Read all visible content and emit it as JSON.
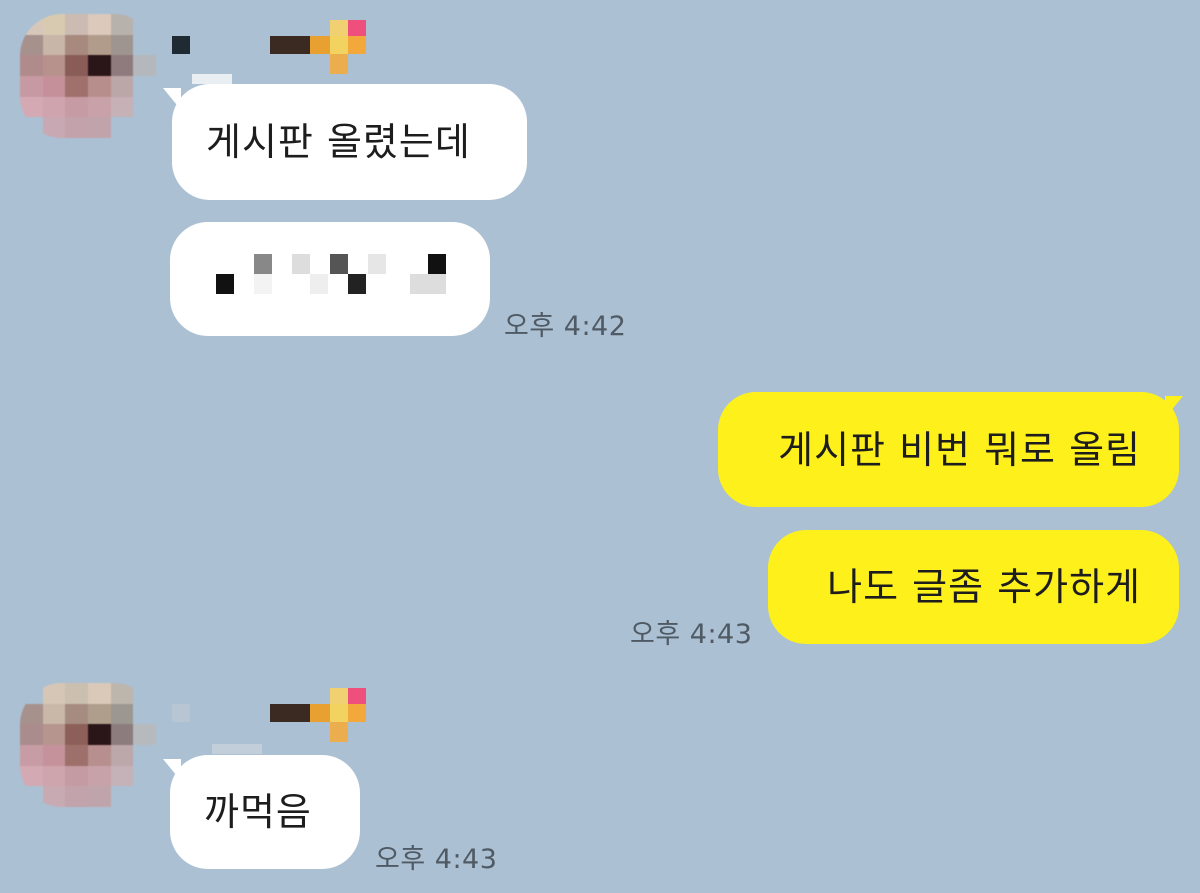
{
  "chat": {
    "theme": {
      "background": "#abc0d3",
      "incoming_bubble": "#ffffff",
      "outgoing_bubble": "#fef01b",
      "time_color": "#4f5a64"
    },
    "messages": [
      {
        "direction": "incoming",
        "sender_name_redacted": true,
        "avatar_redacted": true,
        "bubbles": [
          {
            "text": "게시판 올렸는데"
          },
          {
            "text": "",
            "redacted": true
          }
        ],
        "time": "오후 4:42"
      },
      {
        "direction": "outgoing",
        "bubbles": [
          {
            "text": "게시판 비번 뭐로 올림"
          },
          {
            "text": "나도 글좀 추가하게"
          }
        ],
        "time": "오후 4:43"
      },
      {
        "direction": "incoming",
        "sender_name_redacted": true,
        "avatar_redacted": true,
        "bubbles": [
          {
            "text": "까먹음"
          }
        ],
        "time": "오후 4:43"
      }
    ]
  }
}
